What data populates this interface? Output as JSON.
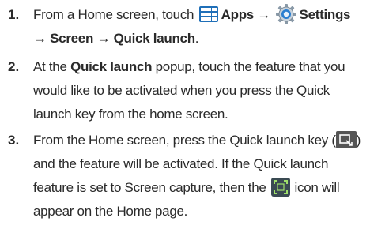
{
  "steps": [
    {
      "number": "1.",
      "line1": {
        "pre": "From a Home screen, touch",
        "apps": "Apps",
        "arrow1": "→",
        "settings": "Settings"
      },
      "line2": {
        "arrow2": "→",
        "screen": "Screen",
        "arrow3": "→",
        "quick_launch": "Quick launch",
        "period": "."
      }
    },
    {
      "number": "2.",
      "line1": {
        "pre": "At the",
        "bold": "Quick launch",
        "post": "popup, touch the feature that you"
      },
      "line2": "would like to be activated when you press the Quick",
      "line3": "launch key from the home screen."
    },
    {
      "number": "3.",
      "line1": {
        "pre": "From the Home screen, press the Quick launch key (",
        "post": ")"
      },
      "line2": "and the feature will be activated. If the Quick launch",
      "line3": {
        "pre": "feature is set to Screen capture, then the",
        "post": "icon will"
      },
      "line4": "appear on the Home page."
    }
  ],
  "icons": {
    "apps": "apps-grid-icon",
    "settings": "settings-gear-icon",
    "quick_launch_key": "quick-launch-key-icon",
    "screen_capture": "screen-capture-icon"
  },
  "colors": {
    "text": "#2a2a2a",
    "apps_blue": "#1f6fb8",
    "settings_blue": "#2b7fd0",
    "key_gray": "#555555"
  }
}
